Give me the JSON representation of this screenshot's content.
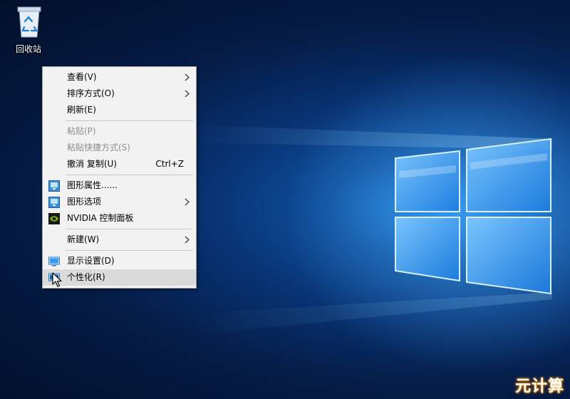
{
  "desktop": {
    "recycle_bin": {
      "label": "回收站",
      "icon": "recycle-bin-icon"
    },
    "wallpaper": {
      "accent": "#2b9bff",
      "background": "#051c46"
    }
  },
  "context_menu": {
    "items": [
      {
        "label": "查看(V)",
        "submenu": true,
        "enabled": true
      },
      {
        "label": "排序方式(O)",
        "submenu": true,
        "enabled": true
      },
      {
        "label": "刷新(E)",
        "enabled": true
      },
      {
        "label": "粘贴(P)",
        "enabled": false
      },
      {
        "label": "粘贴快捷方式(S)",
        "enabled": false
      },
      {
        "label": "撤消 复制(U)",
        "shortcut": "Ctrl+Z",
        "enabled": true
      },
      {
        "label": "图形属性......",
        "icon": "intel-graphics-icon",
        "enabled": true
      },
      {
        "label": "图形选项",
        "icon": "intel-graphics-icon",
        "submenu": true,
        "enabled": true
      },
      {
        "label": "NVIDIA 控制面板",
        "icon": "nvidia-icon",
        "enabled": true
      },
      {
        "label": "新建(W)",
        "submenu": true,
        "enabled": true
      },
      {
        "label": "显示设置(D)",
        "icon": "display-icon",
        "enabled": true
      },
      {
        "label": "个性化(R)",
        "icon": "personalize-icon",
        "enabled": true,
        "highlighted": true
      }
    ]
  },
  "watermark": {
    "text": "元计算"
  }
}
